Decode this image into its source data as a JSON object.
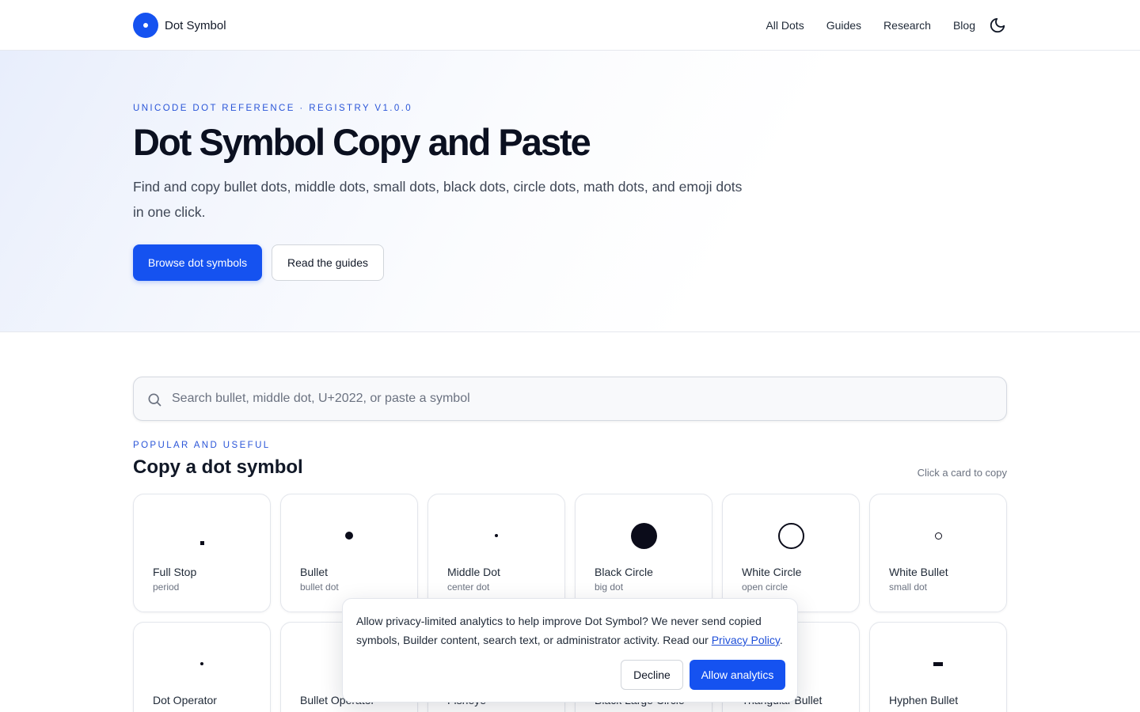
{
  "header": {
    "brand": "Dot Symbol",
    "nav": [
      "All Dots",
      "Guides",
      "Research",
      "Blog"
    ],
    "theme_icon": "moon-icon"
  },
  "hero": {
    "eyebrow": "UNICODE DOT REFERENCE · REGISTRY V1.0.0",
    "title": "Dot Symbol Copy and Paste",
    "subtitle": "Find and copy bullet dots, middle dots, small dots, black dots, circle dots, math dots, and emoji dots in one click.",
    "primary_button": "Browse dot symbols",
    "secondary_button": "Read the guides"
  },
  "search": {
    "placeholder": "Search bullet, middle dot, U+2022, or paste a symbol",
    "icon": "search-icon"
  },
  "section": {
    "eyebrow": "POPULAR AND USEFUL",
    "title": "Copy a dot symbol",
    "hint": "Click a card to copy"
  },
  "cards": [
    {
      "name": "Full Stop",
      "alias": "period",
      "glyph": "."
    },
    {
      "name": "Bullet",
      "alias": "bullet dot",
      "glyph": "•"
    },
    {
      "name": "Middle Dot",
      "alias": "center dot",
      "glyph": "·"
    },
    {
      "name": "Black Circle",
      "alias": "big dot",
      "glyph": "●"
    },
    {
      "name": "White Circle",
      "alias": "open circle",
      "glyph": "○"
    },
    {
      "name": "White Bullet",
      "alias": "small dot",
      "glyph": "◦"
    },
    {
      "name": "Dot Operator",
      "alias": "",
      "glyph": "⋅"
    },
    {
      "name": "Bullet Operator",
      "alias": "",
      "glyph": "∙"
    },
    {
      "name": "Fisheye",
      "alias": "",
      "glyph": "◉"
    },
    {
      "name": "Black Large Circle",
      "alias": "",
      "glyph": "⬤"
    },
    {
      "name": "Triangular Bullet",
      "alias": "",
      "glyph": "‣"
    },
    {
      "name": "Hyphen Bullet",
      "alias": "",
      "glyph": "⁃"
    }
  ],
  "consent": {
    "text": "Allow privacy-limited analytics to help improve Dot Symbol? We never send copied symbols, Builder content, search text, or administrator activity. Read our ",
    "link": "Privacy Policy",
    "end": ".",
    "decline": "Decline",
    "allow": "Allow analytics"
  },
  "colors": {
    "accent": "#1552f0",
    "eyebrow": "#2a55d8",
    "link": "#1d4ed8"
  }
}
